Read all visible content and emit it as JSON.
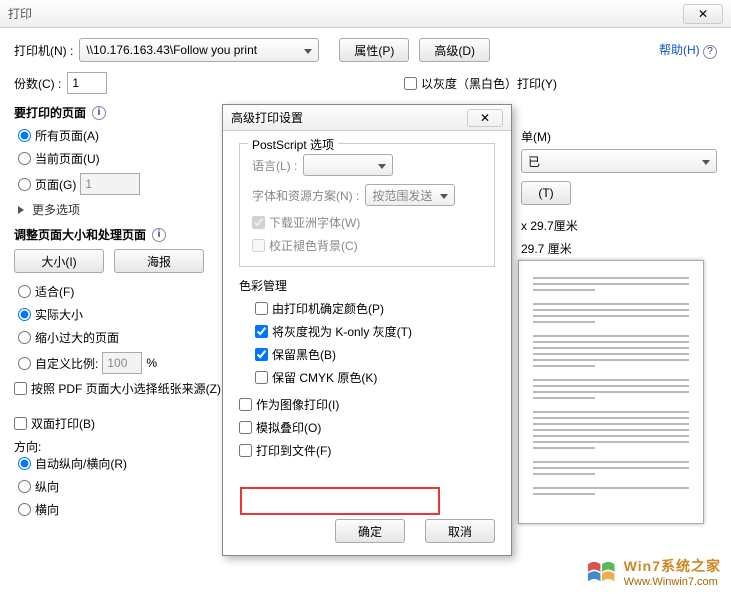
{
  "window": {
    "title": "打印",
    "close_glyph": "✕"
  },
  "main": {
    "printer_label": "打印机(N) :",
    "printer_value": "\\\\10.176.163.43\\Follow you print",
    "properties_btn": "属性(P)",
    "advanced_btn": "高级(D)",
    "help_link": "帮助(H)",
    "copies_label": "份数(C) :",
    "copies_value": "1",
    "grayscale_label": "以灰度（黑白色）打印(Y)"
  },
  "pages_section": {
    "header": "要打印的页面",
    "all_pages": "所有页面(A)",
    "current_page": "当前页面(U)",
    "page_label": "页面(G)",
    "page_value": "1",
    "more_options": "更多选项"
  },
  "size_section": {
    "header": "调整页面大小和处理页面",
    "size_btn": "大小(I)",
    "poster_btn": "海报",
    "fit": "适合(F)",
    "actual_size": "实际大小",
    "shrink_oversize": "缩小过大的页面",
    "custom_scale_label": "自定义比例:",
    "custom_scale_value": "100",
    "percent": "%",
    "choose_by_pdf": "按照 PDF 页面大小选择纸张来源(Z)",
    "duplex": "双面打印(B)",
    "orientation_label": "方向:",
    "auto_orient": "自动纵向/横向(R)",
    "portrait": "纵向",
    "landscape": "横向"
  },
  "right": {
    "sheet_label": "单(M)",
    "sheet_value": "已",
    "reset_btn": "(T)",
    "paper1": "x 29.7厘米",
    "paper2": "29.7 厘米"
  },
  "sub_dialog": {
    "title": "高级打印设置",
    "close_glyph": "✕",
    "ps_header": "PostScript 选项",
    "lang_label": "语言(L) :",
    "font_scheme_label": "字体和资源方案(N) :",
    "font_scheme_value": "按范围发送",
    "download_asian": "下载亚洲字体(W)",
    "correct_bg": "校正褪色背景(C)",
    "color_header": "色彩管理",
    "by_printer": "由打印机确定颜色(P)",
    "gray_konly": "将灰度视为 K-only 灰度(T)",
    "keep_black": "保留黑色(B)",
    "keep_cmyk": "保留 CMYK 原色(K)",
    "print_as_image": "作为图像打印(I)",
    "simulate_overprint": "模拟叠印(O)",
    "print_to_file": "打印到文件(F)",
    "ok_btn": "确定",
    "cancel_btn": "取消"
  },
  "watermark": {
    "cn": "Win7系统之家",
    "en": "Www.Winwin7.com"
  }
}
